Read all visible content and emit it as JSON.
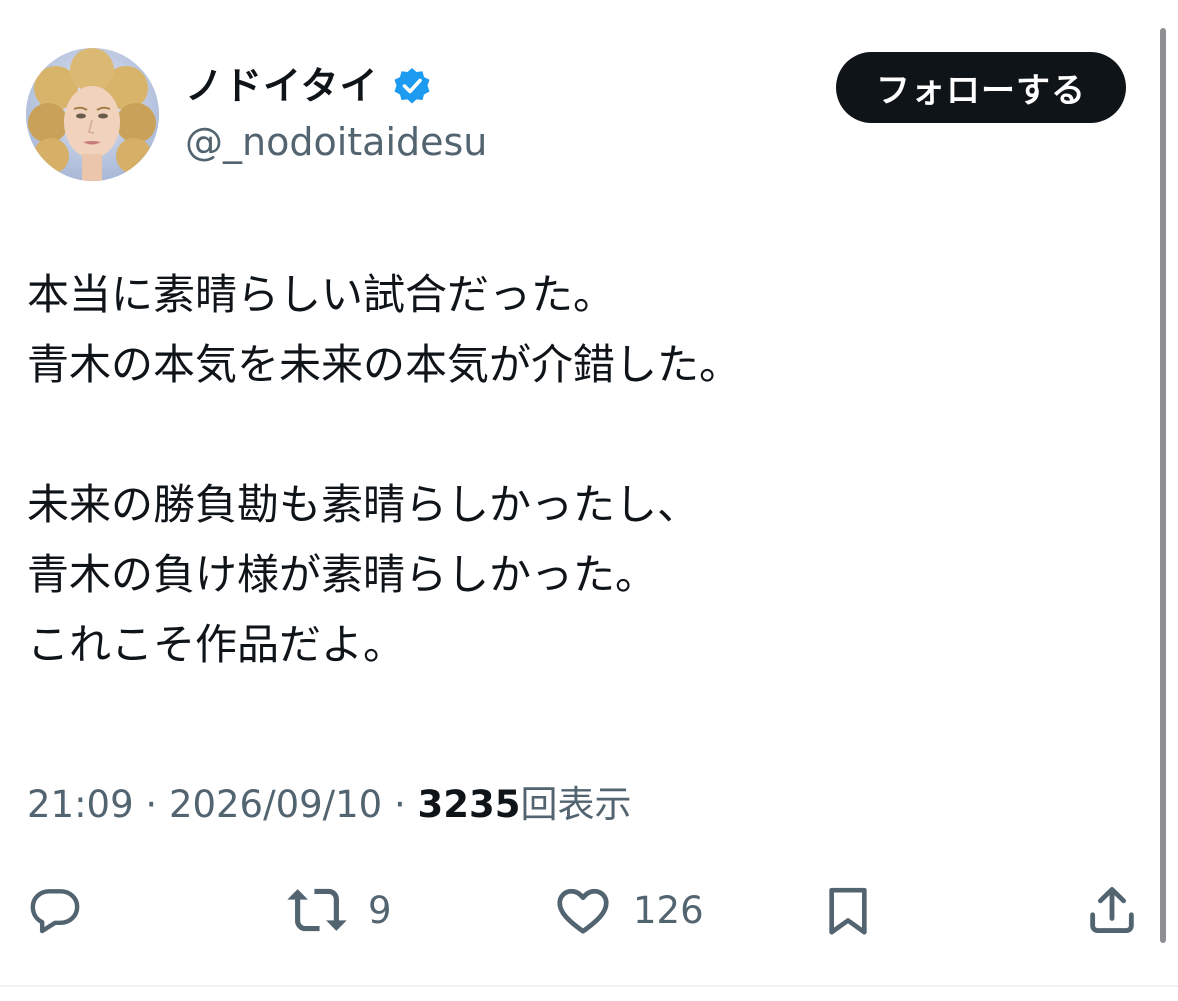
{
  "author": {
    "display_name": "ノドイタイ",
    "handle": "@_nodoitaidesu",
    "verified": true,
    "avatar": "profile-avatar"
  },
  "follow_button": {
    "label": "フォローする"
  },
  "tweet": {
    "lines": [
      "本当に素晴らしい試合だった。",
      "青木の本気を未来の本気が介錯した。",
      "",
      "未来の勝負勘も素晴らしかったし、",
      "青木の負け様が素晴らしかった。",
      "これこそ作品だよ。"
    ]
  },
  "meta": {
    "time": "21:09",
    "separator": "·",
    "date": "2026/09/10",
    "views_count": "3235",
    "views_label": "回表示"
  },
  "actions": {
    "reply": {
      "icon": "reply-icon"
    },
    "retweet": {
      "icon": "retweet-icon",
      "count": "9"
    },
    "like": {
      "icon": "heart-icon",
      "count": "126"
    },
    "bookmark": {
      "icon": "bookmark-icon"
    },
    "share": {
      "icon": "share-icon"
    }
  },
  "colors": {
    "text": "#0f1419",
    "secondary": "#536471",
    "verified": "#1d9bf0",
    "button": "#0f1419"
  }
}
